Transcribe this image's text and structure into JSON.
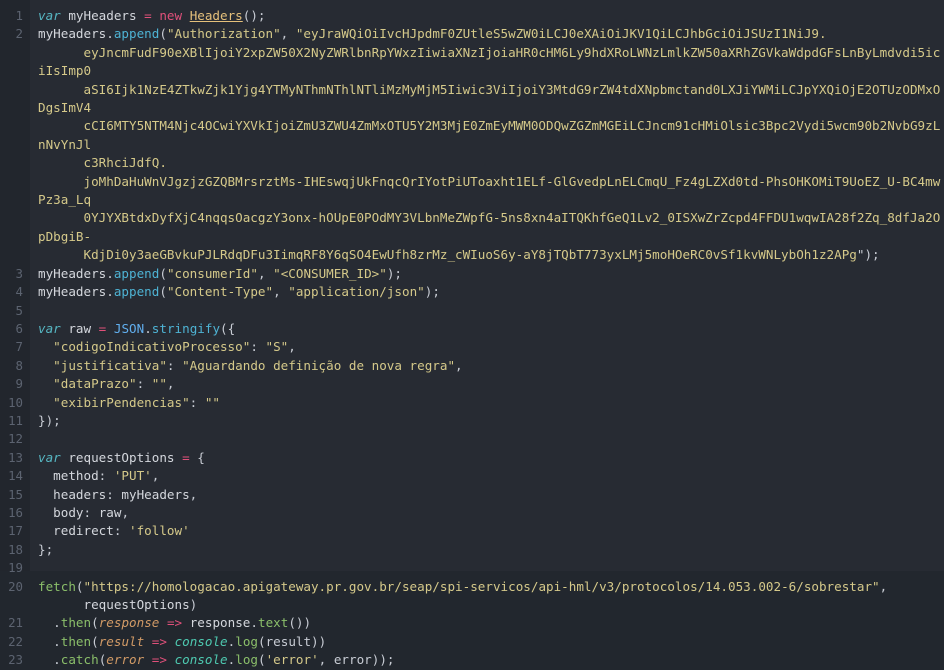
{
  "editor": {
    "name": "code-snippet-viewer",
    "language": "javascript",
    "background_color": "#272b33",
    "gutter_color": "#22262d",
    "line_number_color": "#5c6370",
    "default_text_color": "#d4d7dd",
    "first_line_number": 1,
    "last_line_number": 23,
    "total_lines": 23
  },
  "palette": {
    "keyword": "#56b6c2",
    "operator": "#e0507a",
    "class_name": "#e5c07b",
    "function": "#4eb3d4",
    "string": "#d5c98a",
    "builtin": "#4ec9b0",
    "parameter": "#d19a66",
    "method": "#8bbf6a",
    "punctuation": "#c8ccd4"
  },
  "lines": [
    {
      "number": "1",
      "tokens": [
        {
          "t": "var",
          "c": "t-kw"
        },
        {
          "t": " myHeaders ",
          "c": "t-plain"
        },
        {
          "t": "=",
          "c": "t-op"
        },
        {
          "t": " ",
          "c": "t-plain"
        },
        {
          "t": "new",
          "c": "t-op"
        },
        {
          "t": " ",
          "c": "t-plain"
        },
        {
          "t": "Headers",
          "c": "t-class"
        },
        {
          "t": "();",
          "c": "t-punct"
        }
      ]
    },
    {
      "number": "2",
      "tokens": [
        {
          "t": "myHeaders",
          "c": "t-plain"
        },
        {
          "t": ".",
          "c": "t-punct"
        },
        {
          "t": "append",
          "c": "t-fn"
        },
        {
          "t": "(",
          "c": "t-punct"
        },
        {
          "t": "\"Authorization\"",
          "c": "t-str"
        },
        {
          "t": ", ",
          "c": "t-punct"
        },
        {
          "t": "\"eyJraWQiOiIvcHJpdmF0ZUtleS5wZW0iLCJ0eXAiOiJKV1QiLCJhbGciOiJSUzI1NiJ9.",
          "c": "t-str"
        }
      ]
    },
    {
      "number": "",
      "wrap": true,
      "tokens": [
        {
          "t": "      eyJncmFudF90eXBlIjoiY2xpZW50X2NyZWRlbnRpYWxzIiwiaXNzIjoiaHR0cHM6Ly9hdXRoLWNzLmlkZW50aXRhZGVkaWdpdGFsLnByLmdvdi5iciIsImp0",
          "c": "t-str"
        }
      ]
    },
    {
      "number": "",
      "wrap": true,
      "tokens": [
        {
          "t": "      aSI6Ijk1NzE4ZTkwZjk1Yjg4YTMyNThmNThlNTliMzMyMjM5Iiwic3ViIjoiY3MtdG9rZW4tdXNpbmctand0LXJiYWMiLCJpYXQiOjE2OTUzODMxODgsImV4",
          "c": "t-str"
        }
      ]
    },
    {
      "number": "",
      "wrap": true,
      "tokens": [
        {
          "t": "      cCI6MTY5NTM4Njc4OCwiYXVkIjoiZmU3ZWU4ZmMxOTU5Y2M3MjE0ZmEyMWM0ODQwZGZmMGEiLCJncm91cHMiOlsic3Bpc2Vydi5wcm90b2NvbG9zLnNvYnJl",
          "c": "t-str"
        }
      ]
    },
    {
      "number": "",
      "wrap": true,
      "tokens": [
        {
          "t": "      c3RhciJdfQ.",
          "c": "t-str"
        }
      ]
    },
    {
      "number": "",
      "wrap": true,
      "tokens": [
        {
          "t": "      joMhDaHuWnVJgzjzGZQBMrsrztMs-IHEswqjUkFnqcQrIYotPiUToaxht1ELf-GlGvedpLnELCmqU_Fz4gLZXd0td-PhsOHKOMiT9UoEZ_U-BC4mwPz3a_Lq",
          "c": "t-str"
        }
      ]
    },
    {
      "number": "",
      "wrap": true,
      "tokens": [
        {
          "t": "      0YJYXBtdxDyfXjC4nqqsOacgzY3onx-hOUpE0POdMY3VLbnMeZWpfG-5ns8xn4aITQKhfGeQ1Lv2_0ISXwZrZcpd4FFDU1wqwIA28f2Zq_8dfJa2OpDbgiB-",
          "c": "t-str"
        }
      ]
    },
    {
      "number": "",
      "wrap": true,
      "tokens": [
        {
          "t": "      KdjDi0y3aeGBvkuPJLRdqDFu3IimqRF8Y6qSO4EwUfh8zrMz_cWIuoS6y-aY8jTQbT773yxLMj5moHOeRC0vSf1kvWNLybOh1z2APg",
          "c": "t-str"
        },
        {
          "t": "\");",
          "c": "t-punct"
        }
      ]
    },
    {
      "number": "3",
      "tokens": [
        {
          "t": "myHeaders",
          "c": "t-plain"
        },
        {
          "t": ".",
          "c": "t-punct"
        },
        {
          "t": "append",
          "c": "t-fn"
        },
        {
          "t": "(",
          "c": "t-punct"
        },
        {
          "t": "\"consumerId\"",
          "c": "t-str"
        },
        {
          "t": ", ",
          "c": "t-punct"
        },
        {
          "t": "\"<CONSUMER_ID>\"",
          "c": "t-str"
        },
        {
          "t": ");",
          "c": "t-punct"
        }
      ]
    },
    {
      "number": "4",
      "tokens": [
        {
          "t": "myHeaders",
          "c": "t-plain"
        },
        {
          "t": ".",
          "c": "t-punct"
        },
        {
          "t": "append",
          "c": "t-fn"
        },
        {
          "t": "(",
          "c": "t-punct"
        },
        {
          "t": "\"Content-Type\"",
          "c": "t-str"
        },
        {
          "t": ", ",
          "c": "t-punct"
        },
        {
          "t": "\"application/json\"",
          "c": "t-str"
        },
        {
          "t": ");",
          "c": "t-punct"
        }
      ]
    },
    {
      "number": "5",
      "tokens": []
    },
    {
      "number": "6",
      "tokens": [
        {
          "t": "var",
          "c": "t-kw"
        },
        {
          "t": " raw ",
          "c": "t-plain"
        },
        {
          "t": "=",
          "c": "t-op"
        },
        {
          "t": " ",
          "c": "t-plain"
        },
        {
          "t": "JSON",
          "c": "t-fn2"
        },
        {
          "t": ".",
          "c": "t-punct"
        },
        {
          "t": "stringify",
          "c": "t-fn"
        },
        {
          "t": "({",
          "c": "t-punct"
        }
      ]
    },
    {
      "number": "7",
      "tokens": [
        {
          "t": "  ",
          "c": "t-plain"
        },
        {
          "t": "\"codigoIndicativoProcesso\"",
          "c": "t-str"
        },
        {
          "t": ": ",
          "c": "t-punct"
        },
        {
          "t": "\"S\"",
          "c": "t-str"
        },
        {
          "t": ",",
          "c": "t-punct"
        }
      ]
    },
    {
      "number": "8",
      "tokens": [
        {
          "t": "  ",
          "c": "t-plain"
        },
        {
          "t": "\"justificativa\"",
          "c": "t-str"
        },
        {
          "t": ": ",
          "c": "t-punct"
        },
        {
          "t": "\"Aguardando definição de nova regra\"",
          "c": "t-str"
        },
        {
          "t": ",",
          "c": "t-punct"
        }
      ]
    },
    {
      "number": "9",
      "tokens": [
        {
          "t": "  ",
          "c": "t-plain"
        },
        {
          "t": "\"dataPrazo\"",
          "c": "t-str"
        },
        {
          "t": ": ",
          "c": "t-punct"
        },
        {
          "t": "\"\"",
          "c": "t-str"
        },
        {
          "t": ",",
          "c": "t-punct"
        }
      ]
    },
    {
      "number": "10",
      "tokens": [
        {
          "t": "  ",
          "c": "t-plain"
        },
        {
          "t": "\"exibirPendencias\"",
          "c": "t-str"
        },
        {
          "t": ": ",
          "c": "t-punct"
        },
        {
          "t": "\"\"",
          "c": "t-str"
        }
      ]
    },
    {
      "number": "11",
      "tokens": [
        {
          "t": "});",
          "c": "t-punct"
        }
      ]
    },
    {
      "number": "12",
      "tokens": []
    },
    {
      "number": "13",
      "tokens": [
        {
          "t": "var",
          "c": "t-kw"
        },
        {
          "t": " requestOptions ",
          "c": "t-plain"
        },
        {
          "t": "=",
          "c": "t-op"
        },
        {
          "t": " {",
          "c": "t-punct"
        }
      ]
    },
    {
      "number": "14",
      "tokens": [
        {
          "t": "  method",
          "c": "t-plain"
        },
        {
          "t": ": ",
          "c": "t-punct"
        },
        {
          "t": "'PUT'",
          "c": "t-str"
        },
        {
          "t": ",",
          "c": "t-punct"
        }
      ]
    },
    {
      "number": "15",
      "tokens": [
        {
          "t": "  headers",
          "c": "t-plain"
        },
        {
          "t": ": ",
          "c": "t-punct"
        },
        {
          "t": "myHeaders",
          "c": "t-plain"
        },
        {
          "t": ",",
          "c": "t-punct"
        }
      ]
    },
    {
      "number": "16",
      "tokens": [
        {
          "t": "  body",
          "c": "t-plain"
        },
        {
          "t": ": ",
          "c": "t-punct"
        },
        {
          "t": "raw",
          "c": "t-plain"
        },
        {
          "t": ",",
          "c": "t-punct"
        }
      ]
    },
    {
      "number": "17",
      "tokens": [
        {
          "t": "  redirect",
          "c": "t-plain"
        },
        {
          "t": ": ",
          "c": "t-punct"
        },
        {
          "t": "'follow'",
          "c": "t-str"
        }
      ]
    },
    {
      "number": "18",
      "tokens": [
        {
          "t": "};",
          "c": "t-punct"
        }
      ]
    },
    {
      "number": "19",
      "tokens": []
    },
    {
      "number": "20",
      "tokens": [
        {
          "t": "fetch",
          "c": "t-fetch"
        },
        {
          "t": "(",
          "c": "t-punct"
        },
        {
          "t": "\"https://homologacao.apigateway.pr.gov.br/seap/spi-servicos/api-hml/v3/protocolos/14.053.002-6/sobrestar\"",
          "c": "t-str"
        },
        {
          "t": ",",
          "c": "t-punct"
        }
      ]
    },
    {
      "number": "",
      "wrap": true,
      "tokens": [
        {
          "t": "      requestOptions",
          "c": "t-plain"
        },
        {
          "t": ")",
          "c": "t-punct"
        }
      ]
    },
    {
      "number": "21",
      "tokens": [
        {
          "t": "  .",
          "c": "t-punct"
        },
        {
          "t": "then",
          "c": "t-method"
        },
        {
          "t": "(",
          "c": "t-punct"
        },
        {
          "t": "response",
          "c": "t-param"
        },
        {
          "t": " ",
          "c": "t-plain"
        },
        {
          "t": "=>",
          "c": "t-op"
        },
        {
          "t": " response",
          "c": "t-plain"
        },
        {
          "t": ".",
          "c": "t-punct"
        },
        {
          "t": "text",
          "c": "t-method"
        },
        {
          "t": "())",
          "c": "t-punct"
        }
      ]
    },
    {
      "number": "22",
      "tokens": [
        {
          "t": "  .",
          "c": "t-punct"
        },
        {
          "t": "then",
          "c": "t-method"
        },
        {
          "t": "(",
          "c": "t-punct"
        },
        {
          "t": "result",
          "c": "t-param"
        },
        {
          "t": " ",
          "c": "t-plain"
        },
        {
          "t": "=>",
          "c": "t-op"
        },
        {
          "t": " ",
          "c": "t-plain"
        },
        {
          "t": "console",
          "c": "t-builtin"
        },
        {
          "t": ".",
          "c": "t-punct"
        },
        {
          "t": "log",
          "c": "t-method"
        },
        {
          "t": "(result))",
          "c": "t-punct"
        }
      ]
    },
    {
      "number": "23",
      "tokens": [
        {
          "t": "  .",
          "c": "t-punct"
        },
        {
          "t": "catch",
          "c": "t-method"
        },
        {
          "t": "(",
          "c": "t-punct"
        },
        {
          "t": "error",
          "c": "t-param"
        },
        {
          "t": " ",
          "c": "t-plain"
        },
        {
          "t": "=>",
          "c": "t-op"
        },
        {
          "t": " ",
          "c": "t-plain"
        },
        {
          "t": "console",
          "c": "t-builtin"
        },
        {
          "t": ".",
          "c": "t-punct"
        },
        {
          "t": "log",
          "c": "t-method"
        },
        {
          "t": "(",
          "c": "t-punct"
        },
        {
          "t": "'error'",
          "c": "t-str"
        },
        {
          "t": ", error));",
          "c": "t-punct"
        }
      ]
    }
  ]
}
